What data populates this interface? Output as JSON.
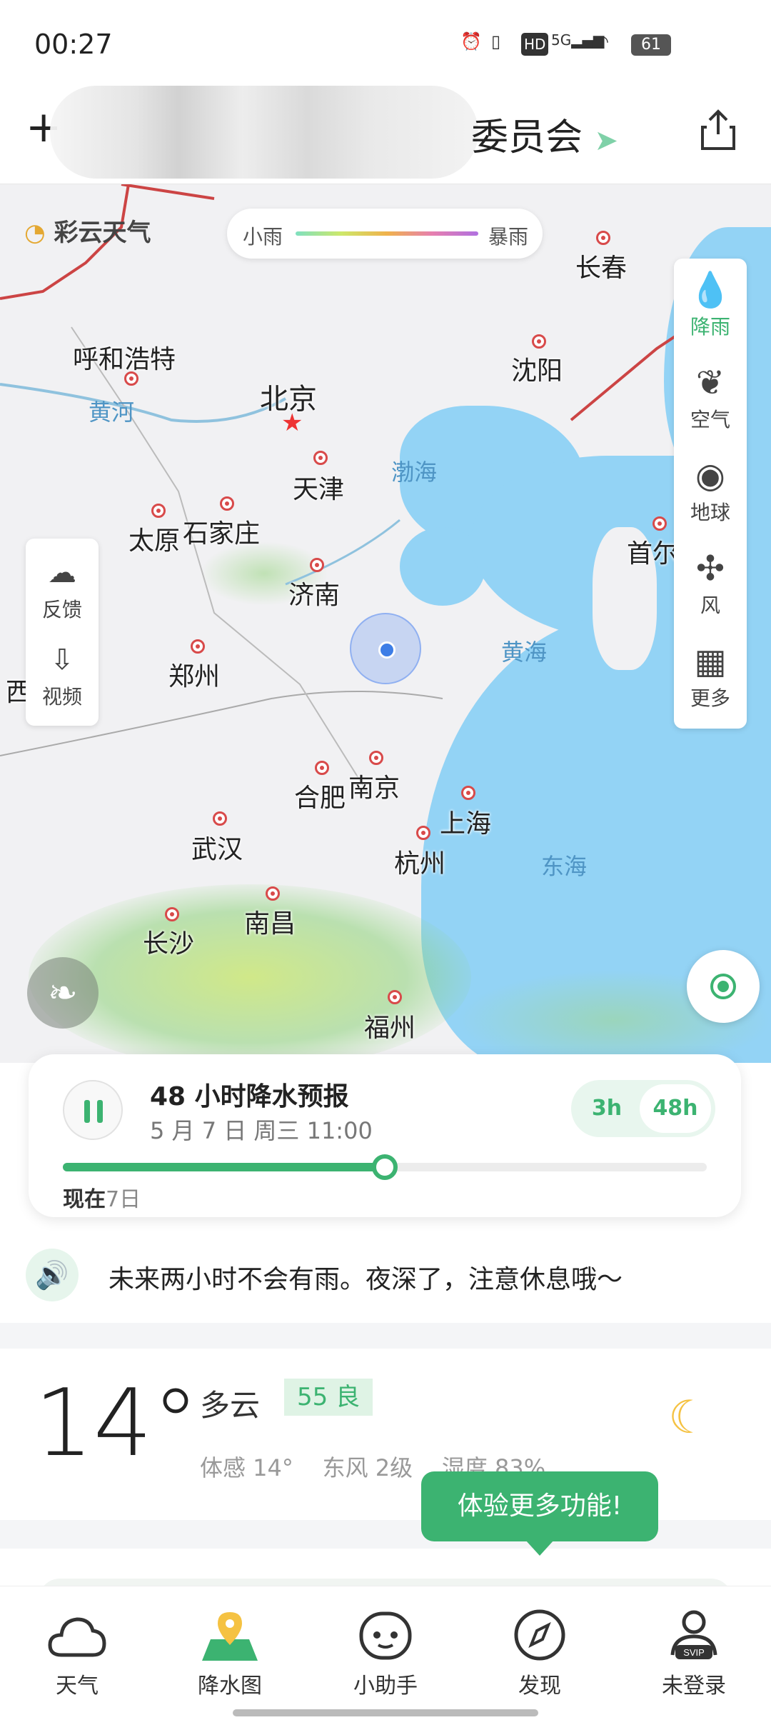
{
  "status_bar": {
    "time": "00:27",
    "battery": "61",
    "net": "5G"
  },
  "header": {
    "title": "委员会"
  },
  "map": {
    "logo": "彩云天气",
    "legend": {
      "min_label": "小雨",
      "max_label": "暴雨"
    },
    "cities": [
      "长春",
      "呼和浩特",
      "沈阳",
      "北京",
      "天津",
      "太原",
      "石家庄",
      "济南",
      "郑州",
      "合肥",
      "南京",
      "上海",
      "武汉",
      "杭州",
      "南昌",
      "长沙",
      "福州",
      "首尔",
      "西"
    ],
    "seas": [
      "黄河",
      "渤海",
      "黄海",
      "东海"
    ],
    "layers": [
      "降雨",
      "空气",
      "地球",
      "风",
      "更多"
    ],
    "left_tools": [
      "反馈",
      "视频"
    ]
  },
  "forecast": {
    "title": "48 小时降水预报",
    "datetime": "5 月 7 日 周三 11:00",
    "seg_3h": "3h",
    "seg_48h": "48h",
    "progress": 0.5,
    "now_label": "现在",
    "day_label": "7日"
  },
  "tip": {
    "text": "未来两小时不会有雨。夜深了，注意休息哦～"
  },
  "weather": {
    "temp": "14°",
    "condition": "多云",
    "aqi": "55 良",
    "feels": "体感 14°",
    "wind": "东风 2级",
    "humidity": "湿度 83%"
  },
  "tooltip": {
    "text": "体验更多功能!"
  },
  "nav": [
    "天气",
    "降水图",
    "小助手",
    "发现",
    "未登录"
  ],
  "colors": {
    "accent": "#3cb371",
    "sea": "#93d3f5"
  }
}
